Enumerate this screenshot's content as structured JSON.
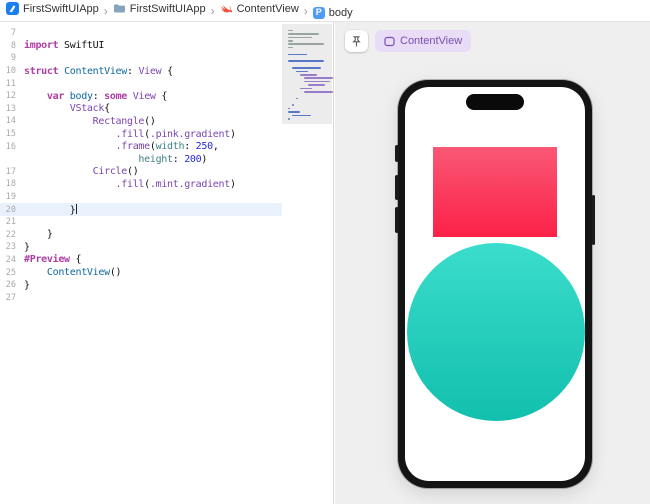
{
  "breadcrumb": {
    "separator": "›",
    "items": [
      {
        "icon": "app-project-icon",
        "label": "FirstSwiftUIApp"
      },
      {
        "icon": "folder-icon",
        "label": "FirstSwiftUIApp"
      },
      {
        "icon": "swift-file-icon",
        "label": "ContentView"
      },
      {
        "icon": "property-icon",
        "badge": "P",
        "label": "body"
      }
    ]
  },
  "editor": {
    "current_line": "20",
    "lines": [
      {
        "n": "7",
        "segs": []
      },
      {
        "n": "8",
        "segs": [
          {
            "c": "kw",
            "t": "import"
          },
          {
            "c": "pl",
            "t": " SwiftUI"
          }
        ]
      },
      {
        "n": "9",
        "segs": []
      },
      {
        "n": "10",
        "segs": [
          {
            "c": "kw",
            "t": "struct"
          },
          {
            "c": "pl",
            "t": " "
          },
          {
            "c": "dc",
            "t": "ContentView"
          },
          {
            "c": "pl",
            "t": ": "
          },
          {
            "c": "ty",
            "t": "View"
          },
          {
            "c": "pl",
            "t": " {"
          }
        ]
      },
      {
        "n": "11",
        "segs": []
      },
      {
        "n": "12",
        "segs": [
          {
            "c": "pl",
            "t": "    "
          },
          {
            "c": "kw",
            "t": "var"
          },
          {
            "c": "pl",
            "t": " "
          },
          {
            "c": "dc",
            "t": "body"
          },
          {
            "c": "pl",
            "t": ": "
          },
          {
            "c": "kw",
            "t": "some"
          },
          {
            "c": "pl",
            "t": " "
          },
          {
            "c": "ty",
            "t": "View"
          },
          {
            "c": "pl",
            "t": " {"
          }
        ]
      },
      {
        "n": "13",
        "segs": [
          {
            "c": "pl",
            "t": "        "
          },
          {
            "c": "ty",
            "t": "VStack"
          },
          {
            "c": "pl",
            "t": "{"
          }
        ]
      },
      {
        "n": "14",
        "segs": [
          {
            "c": "pl",
            "t": "            "
          },
          {
            "c": "ty",
            "t": "Rectangle"
          },
          {
            "c": "pl",
            "t": "()"
          }
        ]
      },
      {
        "n": "15",
        "segs": [
          {
            "c": "pl",
            "t": "                "
          },
          {
            "c": "ty",
            "t": ".fill"
          },
          {
            "c": "pl",
            "t": "("
          },
          {
            "c": "ty",
            "t": ".pink.gradient"
          },
          {
            "c": "pl",
            "t": ")"
          }
        ]
      },
      {
        "n": "16",
        "segs": [
          {
            "c": "pl",
            "t": "                "
          },
          {
            "c": "ty",
            "t": ".frame"
          },
          {
            "c": "pl",
            "t": "("
          },
          {
            "c": "ar",
            "t": "width"
          },
          {
            "c": "pl",
            "t": ": "
          },
          {
            "c": "nu",
            "t": "250"
          },
          {
            "c": "pl",
            "t": ","
          }
        ]
      },
      {
        "n": "",
        "segs": [
          {
            "c": "pl",
            "t": "                    "
          },
          {
            "c": "ar",
            "t": "height"
          },
          {
            "c": "pl",
            "t": ": "
          },
          {
            "c": "nu",
            "t": "200"
          },
          {
            "c": "pl",
            "t": ")"
          }
        ]
      },
      {
        "n": "17",
        "segs": [
          {
            "c": "pl",
            "t": "            "
          },
          {
            "c": "ty",
            "t": "Circle"
          },
          {
            "c": "pl",
            "t": "()"
          }
        ]
      },
      {
        "n": "18",
        "segs": [
          {
            "c": "pl",
            "t": "                "
          },
          {
            "c": "ty",
            "t": ".fill"
          },
          {
            "c": "pl",
            "t": "("
          },
          {
            "c": "ty",
            "t": ".mint.gradient"
          },
          {
            "c": "pl",
            "t": ")"
          }
        ]
      },
      {
        "n": "19",
        "segs": []
      },
      {
        "n": "20",
        "caret": true,
        "segs": [
          {
            "c": "pl",
            "t": "        }"
          }
        ]
      },
      {
        "n": "21",
        "segs": []
      },
      {
        "n": "22",
        "segs": [
          {
            "c": "pl",
            "t": "    }"
          }
        ]
      },
      {
        "n": "23",
        "segs": [
          {
            "c": "pl",
            "t": "}"
          }
        ]
      },
      {
        "n": "24",
        "segs": [
          {
            "c": "kw",
            "t": "#Preview"
          },
          {
            "c": "pl",
            "t": " {"
          }
        ]
      },
      {
        "n": "25",
        "segs": [
          {
            "c": "pl",
            "t": "    "
          },
          {
            "c": "dc",
            "t": "ContentView"
          },
          {
            "c": "pl",
            "t": "()"
          }
        ]
      },
      {
        "n": "26",
        "segs": [
          {
            "c": "pl",
            "t": "}"
          }
        ]
      },
      {
        "n": "27",
        "segs": []
      }
    ]
  },
  "minimap": {
    "rows": [
      {
        "i": 0,
        "w": 2,
        "c": "g"
      },
      {
        "i": 0,
        "w": 13,
        "c": "g"
      },
      {
        "i": 0,
        "w": 10,
        "c": "g"
      },
      {
        "i": 0,
        "w": 2,
        "c": "g"
      },
      {
        "i": 0,
        "w": 15,
        "c": "g"
      },
      {
        "i": 0,
        "w": 2,
        "c": "g"
      },
      {
        "i": 0,
        "w": 0,
        "c": "b"
      },
      {
        "i": 0,
        "w": 8,
        "c": "b"
      },
      {
        "i": 0,
        "w": 0,
        "c": "b"
      },
      {
        "i": 0,
        "w": 15,
        "c": "b"
      },
      {
        "i": 0,
        "w": 0,
        "c": "b"
      },
      {
        "i": 2,
        "w": 12,
        "c": "b"
      },
      {
        "i": 4,
        "w": 5,
        "c": "b"
      },
      {
        "i": 6,
        "w": 7,
        "c": "p"
      },
      {
        "i": 8,
        "w": 12,
        "c": "p"
      },
      {
        "i": 8,
        "w": 11,
        "c": "p"
      },
      {
        "i": 10,
        "w": 7,
        "c": "p"
      },
      {
        "i": 6,
        "w": 5,
        "c": "p"
      },
      {
        "i": 8,
        "w": 12,
        "c": "p"
      },
      {
        "i": 0,
        "w": 0,
        "c": "b"
      },
      {
        "i": 4,
        "w": 1,
        "c": "b"
      },
      {
        "i": 0,
        "w": 0,
        "c": "b"
      },
      {
        "i": 2,
        "w": 1,
        "c": "b"
      },
      {
        "i": 0,
        "w": 1,
        "c": "b"
      },
      {
        "i": 0,
        "w": 5,
        "c": "b"
      },
      {
        "i": 2,
        "w": 8,
        "c": "b"
      },
      {
        "i": 0,
        "w": 1,
        "c": "b"
      },
      {
        "i": 0,
        "w": 0,
        "c": "b"
      }
    ]
  },
  "canvas": {
    "preview_chip_label": "ContentView"
  },
  "colors": {
    "keyword": "#AD3DA4",
    "type": "#7A45B0",
    "declaration": "#0F68A0",
    "argument": "#3E8087",
    "number": "#272AD8",
    "chip_bg": "#E8DCF6",
    "chip_text": "#7A4FB0",
    "rect_top": "#FA5876",
    "rect_bottom": "#FB2147",
    "circle_top": "#3BDDCC",
    "circle_bottom": "#12BFAD",
    "minimap_comment": "#9AA5A0",
    "minimap_code": "#5A78C8",
    "minimap_member": "#9A7CC8"
  }
}
